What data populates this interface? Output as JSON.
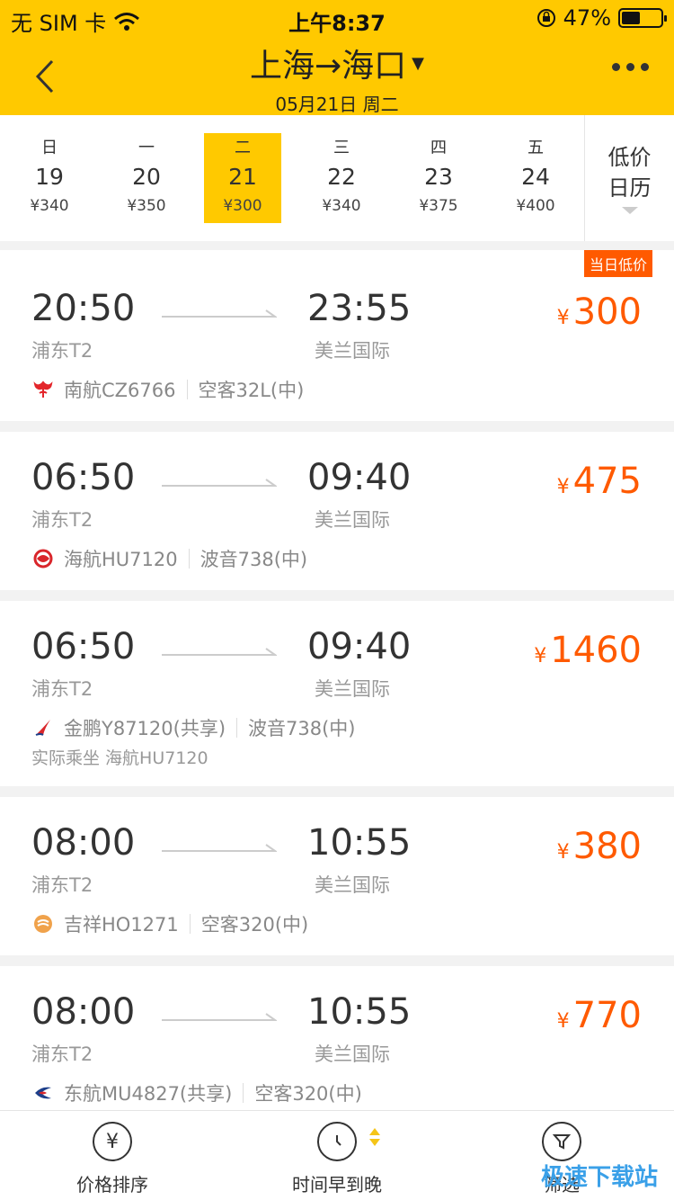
{
  "status": {
    "carrier": "无 SIM 卡",
    "time": "上午8:37",
    "battery": "47%",
    "battery_level": 0.47
  },
  "header": {
    "route": "上海→海口",
    "date": "05月21日 周二"
  },
  "dates": [
    {
      "weekday": "日",
      "day": "19",
      "price": "¥340"
    },
    {
      "weekday": "一",
      "day": "20",
      "price": "¥350"
    },
    {
      "weekday": "二",
      "day": "21",
      "price": "¥300"
    },
    {
      "weekday": "三",
      "day": "22",
      "price": "¥340"
    },
    {
      "weekday": "四",
      "day": "23",
      "price": "¥375"
    },
    {
      "weekday": "五",
      "day": "24",
      "price": "¥400"
    }
  ],
  "calendar": {
    "line1": "低价",
    "line2": "日历"
  },
  "flights": [
    {
      "dep_time": "20:50",
      "arr_time": "23:55",
      "dep_terminal": "浦东T2",
      "arr_terminal": "美兰国际",
      "price": "300",
      "yen": "¥",
      "airline": "南航CZ6766",
      "aircraft": "空客32L(中)",
      "badge": "当日低价",
      "logo": "csa-logo-icon"
    },
    {
      "dep_time": "06:50",
      "arr_time": "09:40",
      "dep_terminal": "浦东T2",
      "arr_terminal": "美兰国际",
      "price": "475",
      "yen": "¥",
      "airline": "海航HU7120",
      "aircraft": "波音738(中)",
      "logo": "hainan-logo-icon"
    },
    {
      "dep_time": "06:50",
      "arr_time": "09:40",
      "dep_terminal": "浦东T2",
      "arr_terminal": "美兰国际",
      "price": "1460",
      "yen": "¥",
      "airline": "金鹏Y87120(共享)",
      "aircraft": "波音738(中)",
      "extra": "实际乘坐 海航HU7120",
      "logo": "jinpeng-logo-icon"
    },
    {
      "dep_time": "08:00",
      "arr_time": "10:55",
      "dep_terminal": "浦东T2",
      "arr_terminal": "美兰国际",
      "price": "380",
      "yen": "¥",
      "airline": "吉祥HO1271",
      "aircraft": "空客320(中)",
      "logo": "juneyao-logo-icon"
    },
    {
      "dep_time": "08:00",
      "arr_time": "10:55",
      "dep_terminal": "浦东T2",
      "arr_terminal": "美兰国际",
      "price": "770",
      "yen": "¥",
      "airline": "东航MU4827(共享)",
      "aircraft": "空客320(中)",
      "logo": "china-eastern-logo-icon"
    }
  ],
  "bottom": {
    "price_sort": "价格排序",
    "time_sort": "时间早到晚",
    "filter": "筛选"
  },
  "watermark": "极速下载站",
  "colors": {
    "accent": "#ffc900",
    "price": "#ff5a00"
  }
}
